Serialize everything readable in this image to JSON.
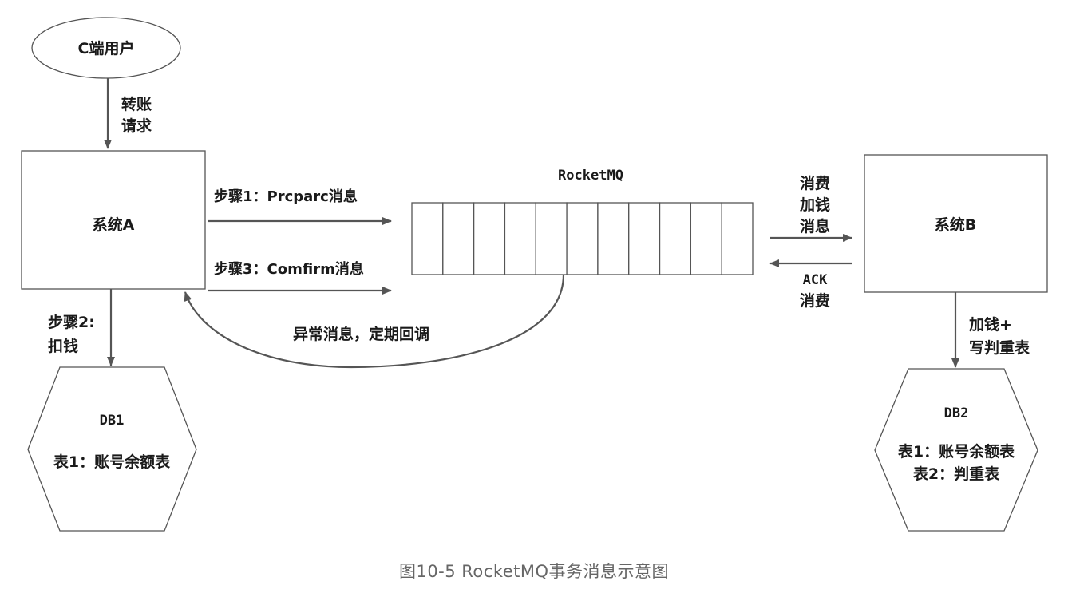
{
  "nodes": {
    "user": "C端用户",
    "system_a": "系统A",
    "system_b": "系统B",
    "rocketmq": "RocketMQ",
    "db1": {
      "title": "DB1",
      "line1": "表1：账号余额表"
    },
    "db2": {
      "title": "DB2",
      "line1": "表1：账号余额表",
      "line2": "表2：判重表"
    }
  },
  "queue": {
    "slot_count": 11
  },
  "edges": {
    "transfer_request": [
      "转账",
      "请求"
    ],
    "step1": "步骤1：Prcparc消息",
    "step3": "步骤3：Comfirm消息",
    "step2": [
      "步骤2:",
      "扣钱"
    ],
    "callback": "异常消息，定期回调",
    "consume": [
      "消费",
      "加钱",
      "消息"
    ],
    "ack": [
      "ACK",
      "消费"
    ],
    "add_money": [
      "加钱+",
      "写判重表"
    ]
  },
  "caption": "图10-5  RocketMQ事务消息示意图",
  "colors": {
    "stroke": "#555555",
    "text": "#1a1a1a",
    "caption": "#666666"
  }
}
